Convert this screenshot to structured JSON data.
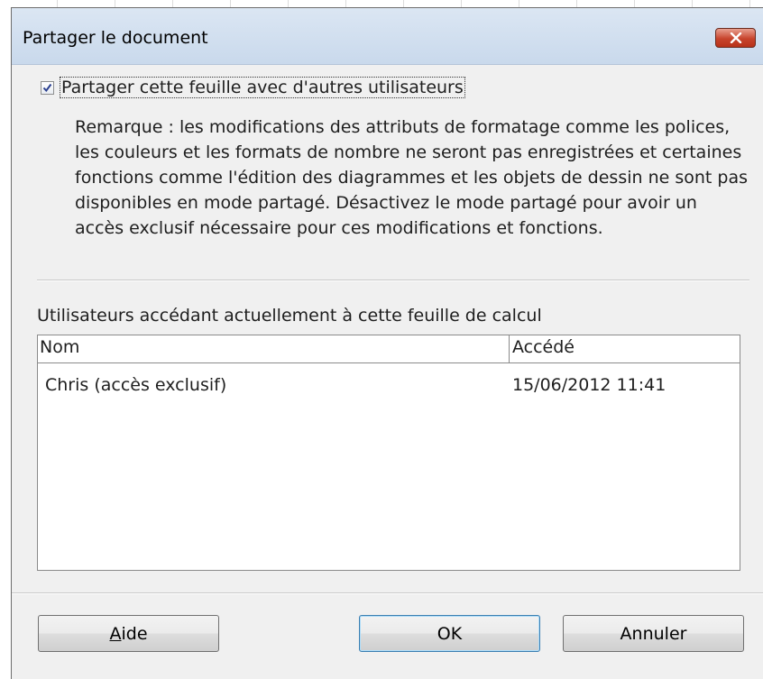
{
  "dialog": {
    "title": "Partager le document"
  },
  "share": {
    "checked": true,
    "label": "Partager cette feuille avec d'autres utilisateurs",
    "note": "Remarque : les modifications des attributs de formatage comme les polices, les couleurs et les formats de nombre ne seront pas enregistrées et certaines fonctions comme l'édition des diagrammes et les objets de dessin ne sont pas disponibles en mode partagé. Désactivez le mode partagé pour avoir un accès exclusif nécessaire pour ces modifications et fonctions."
  },
  "users": {
    "heading": "Utilisateurs accédant actuellement à cette feuille de calcul",
    "columns": {
      "name": "Nom",
      "accessed": "Accédé"
    },
    "rows": [
      {
        "name": "Chris  (accès exclusif)",
        "accessed": "15/06/2012 11:41"
      }
    ]
  },
  "buttons": {
    "help": "Aide",
    "ok": "OK",
    "cancel": "Annuler"
  },
  "colors": {
    "title_bar": "#c9d9ec",
    "close_button": "#c7442c",
    "dialog_bg": "#f0f0f0",
    "default_button_border": "#3c7fb1"
  }
}
